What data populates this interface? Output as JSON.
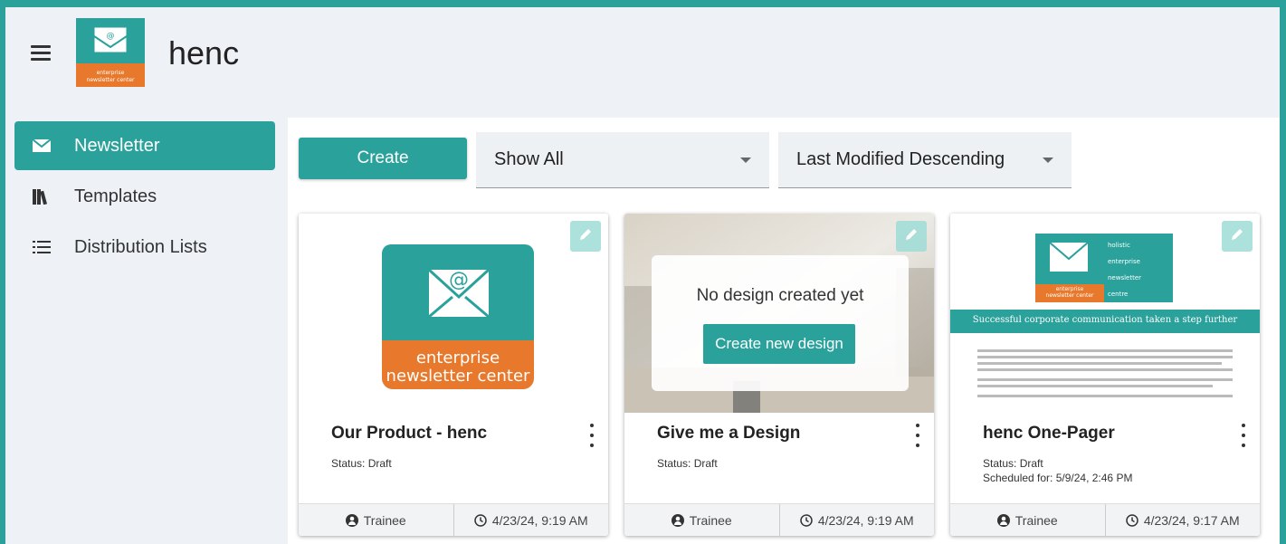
{
  "app": {
    "title": "henc",
    "logo_text_line1": "enterprise",
    "logo_text_line2": "newsletter center"
  },
  "sidebar": {
    "items": [
      {
        "label": "Newsletter",
        "icon": "envelope-icon",
        "active": true
      },
      {
        "label": "Templates",
        "icon": "books-icon",
        "active": false
      },
      {
        "label": "Distribution Lists",
        "icon": "list-icon",
        "active": false
      }
    ]
  },
  "toolbar": {
    "create_label": "Create",
    "filter_value": "Show All",
    "sort_value": "Last Modified Descending"
  },
  "cards": [
    {
      "title": "Our Product - henc",
      "status": "Status: Draft",
      "scheduled": "",
      "author": "Trainee",
      "modified": "4/23/24, 9:19 AM",
      "thumb_text1": "enterprise",
      "thumb_text2": "newsletter center"
    },
    {
      "title": "Give me a Design",
      "status": "Status: Draft",
      "scheduled": "",
      "author": "Trainee",
      "modified": "4/23/24, 9:19 AM",
      "no_design_text": "No design created yet",
      "create_design_label": "Create new design"
    },
    {
      "title": "henc One-Pager",
      "status": "Status: Draft",
      "scheduled": "Scheduled for: 5/9/24, 2:46 PM",
      "author": "Trainee",
      "modified": "4/23/24, 9:17 AM",
      "thumb_banner": "Successful corporate communication taken a step further",
      "thumb_logo1": "enterprise",
      "thumb_logo2": "newsletter center",
      "thumb_side": [
        "holistic",
        "enterprise",
        "newsletter",
        "centre"
      ]
    }
  ],
  "colors": {
    "accent": "#2aa19b",
    "orange": "#e8782b",
    "background": "#eef2f7"
  }
}
